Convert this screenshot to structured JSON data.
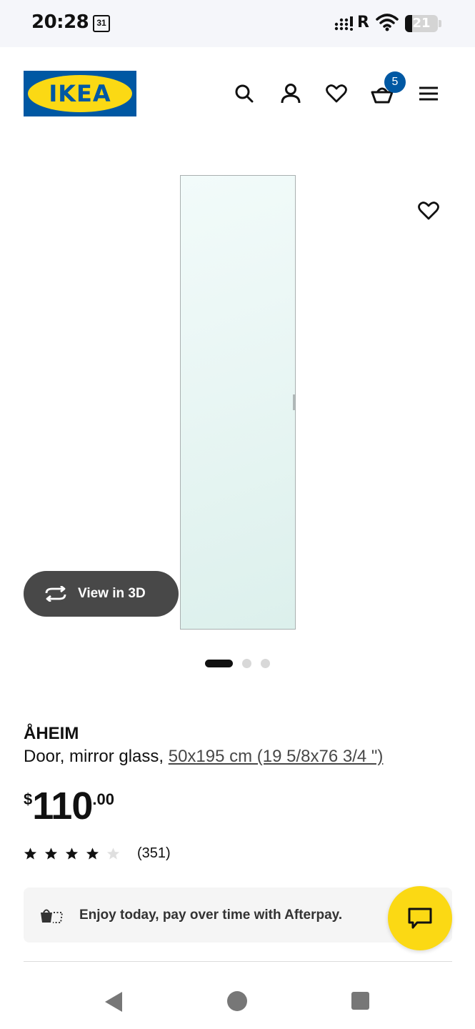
{
  "status_bar": {
    "time": "20:28",
    "calendar_day": "31",
    "roaming_indicator": "R",
    "battery_level": "21",
    "battery_fraction": 0.21
  },
  "header": {
    "logo_text": "IKEA",
    "cart_count": "5",
    "icons": [
      "search-icon",
      "account-icon",
      "heart-icon",
      "cart-icon",
      "menu-icon"
    ]
  },
  "gallery": {
    "view_3d_label": "View in 3D",
    "image_count": 3,
    "active_index": 0
  },
  "product": {
    "name": "ÅHEIM",
    "description": "Door, mirror glass, ",
    "size": "50x195 cm (19 5/8x76 3/4 \")",
    "price_currency": "$",
    "price_integer": "110",
    "price_decimals": ".00",
    "rating_value": 4,
    "rating_max": 5,
    "rating_count": "(351)"
  },
  "afterpay": {
    "text": "Enjoy today, pay over time with Afterpay."
  },
  "colors": {
    "brand_blue": "#0058a3",
    "brand_yellow": "#fbd914",
    "button_dark": "#484848"
  }
}
